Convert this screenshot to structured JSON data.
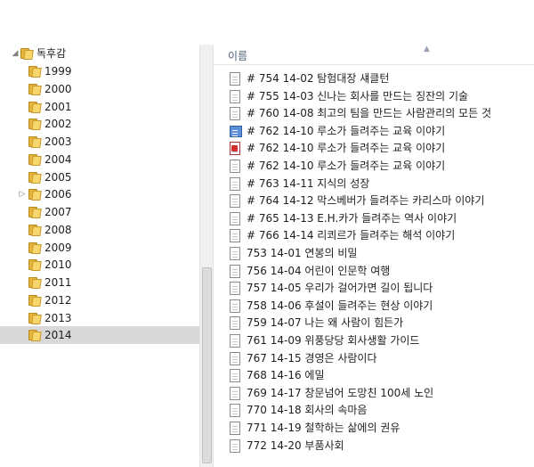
{
  "tree": {
    "root": {
      "label": "독후감",
      "expander": "◢"
    },
    "years": [
      {
        "label": "1999",
        "expander": ""
      },
      {
        "label": "2000",
        "expander": ""
      },
      {
        "label": "2001",
        "expander": ""
      },
      {
        "label": "2002",
        "expander": ""
      },
      {
        "label": "2003",
        "expander": ""
      },
      {
        "label": "2004",
        "expander": ""
      },
      {
        "label": "2005",
        "expander": ""
      },
      {
        "label": "2006",
        "expander": "▷"
      },
      {
        "label": "2007",
        "expander": ""
      },
      {
        "label": "2008",
        "expander": ""
      },
      {
        "label": "2009",
        "expander": ""
      },
      {
        "label": "2010",
        "expander": ""
      },
      {
        "label": "2011",
        "expander": ""
      },
      {
        "label": "2012",
        "expander": ""
      },
      {
        "label": "2013",
        "expander": ""
      },
      {
        "label": "2014",
        "expander": "",
        "selected": true
      }
    ]
  },
  "file_list": {
    "column_name": "이름",
    "sort_indicator": "▲",
    "files": [
      {
        "name": "# 754 14-02 탐험대장 섀클턴",
        "icon": "document-icon"
      },
      {
        "name": "# 755 14-03 신나는 회사를 만드는 징잔의 기술",
        "icon": "document-icon"
      },
      {
        "name": "# 760 14-08 최고의 팀을 만드는 사람관리의 모든 것",
        "icon": "document-icon"
      },
      {
        "name": "# 762 14-10 루소가 들려주는 교육 이야기",
        "icon": "blue-document-icon"
      },
      {
        "name": "# 762 14-10 루소가 들려주는 교육 이야기",
        "icon": "red-document-icon"
      },
      {
        "name": "# 762 14-10 루소가 들려주는 교육 이야기",
        "icon": "document-icon"
      },
      {
        "name": "# 763 14-11 지식의 성장",
        "icon": "document-icon"
      },
      {
        "name": "# 764 14-12 막스베버가 들려주는 카리스마 이야기",
        "icon": "document-icon"
      },
      {
        "name": "# 765 14-13 E.H.카가 들려주는 역사 이야기",
        "icon": "document-icon"
      },
      {
        "name": "# 766 14-14 리쾨르가 들려주는 해석 이야기",
        "icon": "document-icon"
      },
      {
        "name": "753 14-01 연봉의 비밀",
        "icon": "document-icon"
      },
      {
        "name": "756 14-04 어린이 인문학 여행",
        "icon": "document-icon"
      },
      {
        "name": "757 14-05 우리가 걸어가면 길이 됩니다",
        "icon": "document-icon"
      },
      {
        "name": "758 14-06 후설이 들려주는 현상 이야기",
        "icon": "document-icon"
      },
      {
        "name": "759 14-07 나는 왜 사람이 힘든가",
        "icon": "document-icon"
      },
      {
        "name": "761 14-09 위풍당당 회사생활 가이드",
        "icon": "document-icon"
      },
      {
        "name": "767 14-15 경영은 사람이다",
        "icon": "document-icon"
      },
      {
        "name": "768 14-16 에밀",
        "icon": "document-icon"
      },
      {
        "name": "769 14-17 창문넘어 도망친 100세 노인",
        "icon": "document-icon"
      },
      {
        "name": "770 14-18 회사의 속마음",
        "icon": "document-icon"
      },
      {
        "name": "771 14-19 철학하는 삶에의 권유",
        "icon": "document-icon"
      },
      {
        "name": "772 14-20 부품사회",
        "icon": "document-icon"
      }
    ]
  }
}
